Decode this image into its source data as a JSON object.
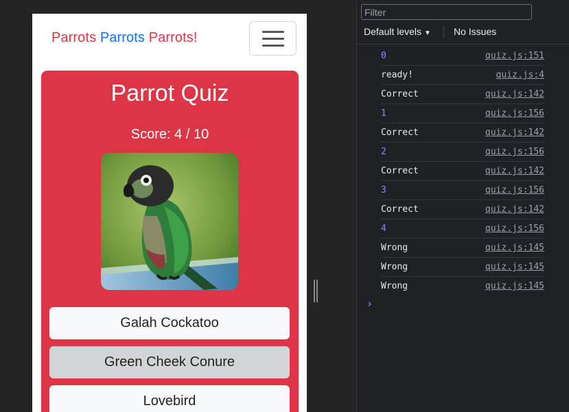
{
  "navbar": {
    "brand_1": "Parrots",
    "brand_2": "Parrots",
    "brand_3": "Parrots!"
  },
  "quiz": {
    "title": "Parrot Quiz",
    "score": "Score: 4 / 10",
    "answers": [
      {
        "label": "Galah Cockatoo"
      },
      {
        "label": "Green Cheek Conure"
      },
      {
        "label": "Lovebird"
      }
    ]
  },
  "devtools": {
    "filter_placeholder": "Filter",
    "levels_label": "Default levels",
    "issues_label": "No Issues",
    "logs": [
      {
        "message": "0",
        "source": "quiz.js:151"
      },
      {
        "message": "ready!",
        "source": "quiz.js:4"
      },
      {
        "message": "Correct",
        "source": "quiz.js:142"
      },
      {
        "message": "1",
        "source": "quiz.js:156"
      },
      {
        "message": "Correct",
        "source": "quiz.js:142"
      },
      {
        "message": "2",
        "source": "quiz.js:156"
      },
      {
        "message": "Correct",
        "source": "quiz.js:142"
      },
      {
        "message": "3",
        "source": "quiz.js:156"
      },
      {
        "message": "Correct",
        "source": "quiz.js:142"
      },
      {
        "message": "4",
        "source": "quiz.js:156"
      },
      {
        "message": "Wrong",
        "source": "quiz.js:145"
      },
      {
        "message": "Wrong",
        "source": "quiz.js:145"
      },
      {
        "message": "Wrong",
        "source": "quiz.js:145"
      }
    ],
    "prompt_symbol": "›"
  },
  "colors": {
    "quiz_card": "#dc3545",
    "brand_red": "#dc3545",
    "brand_blue": "#0d6efd",
    "number_log": "#9980ff"
  }
}
